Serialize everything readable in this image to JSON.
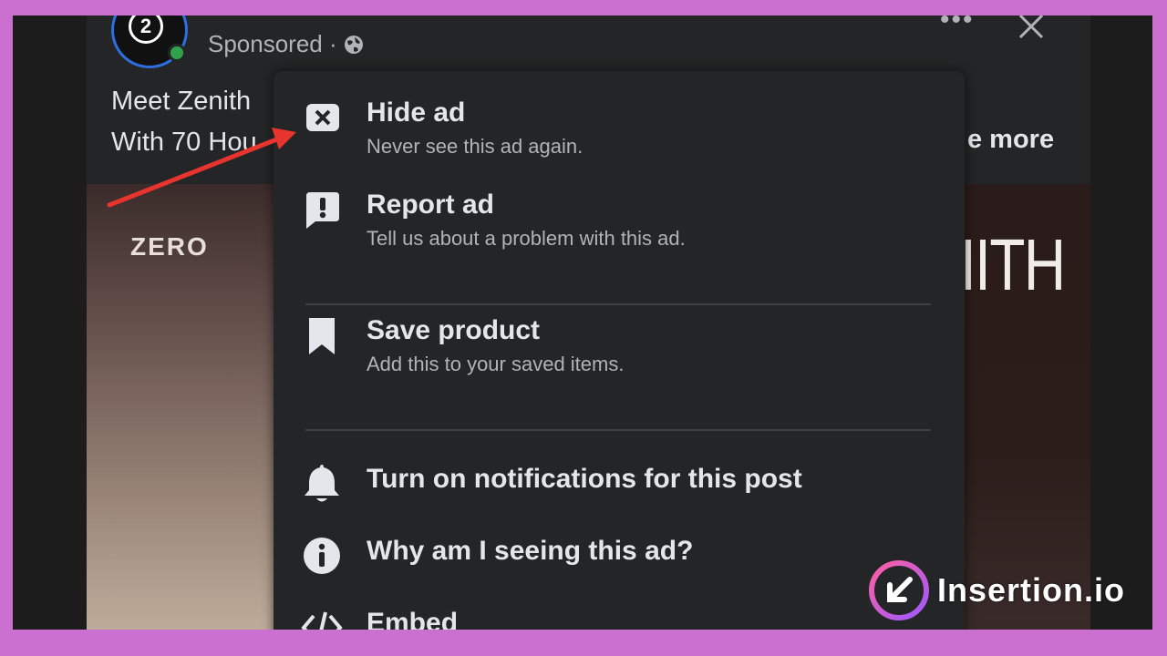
{
  "post": {
    "sponsored_label": "Sponsored ·",
    "caption_line1": "Meet Zenith",
    "caption_line2": "With 70 Hou",
    "see_more": "e more",
    "brand_left": "ZERO",
    "brand_right": "IITH"
  },
  "menu": {
    "items": [
      {
        "icon": "close-box-icon",
        "title": "Hide ad",
        "desc": "Never see this ad again."
      },
      {
        "icon": "report-icon",
        "title": "Report ad",
        "desc": "Tell us about a problem with this ad."
      },
      {
        "icon": "bookmark-icon",
        "title": "Save product",
        "desc": "Add this to your saved items."
      },
      {
        "icon": "bell-icon",
        "title": "Turn on notifications for this post"
      },
      {
        "icon": "info-icon",
        "title": "Why am I seeing this ad?"
      },
      {
        "icon": "code-icon",
        "title": "Embed"
      }
    ]
  },
  "watermark": {
    "text": "Insertion.io"
  },
  "colors": {
    "border": "#cb6fd0",
    "panel": "#242526",
    "text_primary": "#e4e6eb",
    "text_secondary": "#b0b3b8",
    "arrow": "#e8342e",
    "online": "#31a24c"
  }
}
